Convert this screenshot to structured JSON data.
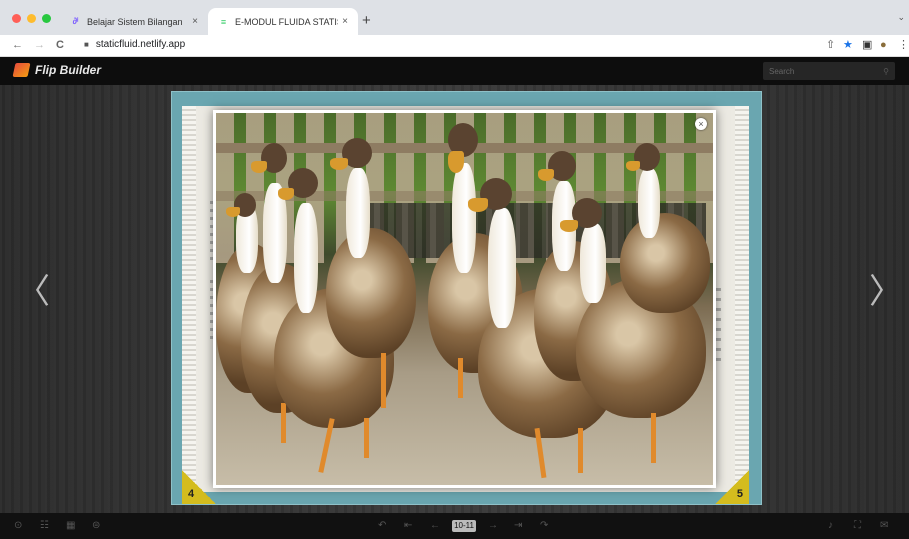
{
  "browser": {
    "tabs": [
      {
        "label": "Belajar Sistem Bilangan",
        "favicon": "∂ⁱ",
        "active": false
      },
      {
        "label": "E-MODUL FLUIDA STATIS",
        "favicon": "≡",
        "active": true
      }
    ],
    "url": "staticfluid.netlify.app",
    "icons": {
      "back": "←",
      "forward": "→",
      "reload": "C",
      "lock": "🔒",
      "share": "⇧",
      "star": "★",
      "sidebar": "▣",
      "avatar": "●",
      "menu": "⋮",
      "new_tab": "+",
      "close": "×"
    }
  },
  "app": {
    "brand": "Flip Builder",
    "search_placeholder": "Search",
    "left_page_number": "4",
    "right_page_number": "5",
    "page_indicator": "10-11",
    "prev_arrow": "〈",
    "next_arrow": "〉",
    "popup_close": "×",
    "toolbar_glyphs": [
      "⊙",
      "☷",
      "▦",
      "⊜",
      "↶",
      "⇤",
      "←",
      "→",
      "⇥",
      "↷",
      "♪",
      "⛶",
      "✉"
    ]
  },
  "colors": {
    "star_blue": "#1a73e8",
    "book_teal": "#6aa6b0",
    "page_corner": "#d4bc1e"
  }
}
